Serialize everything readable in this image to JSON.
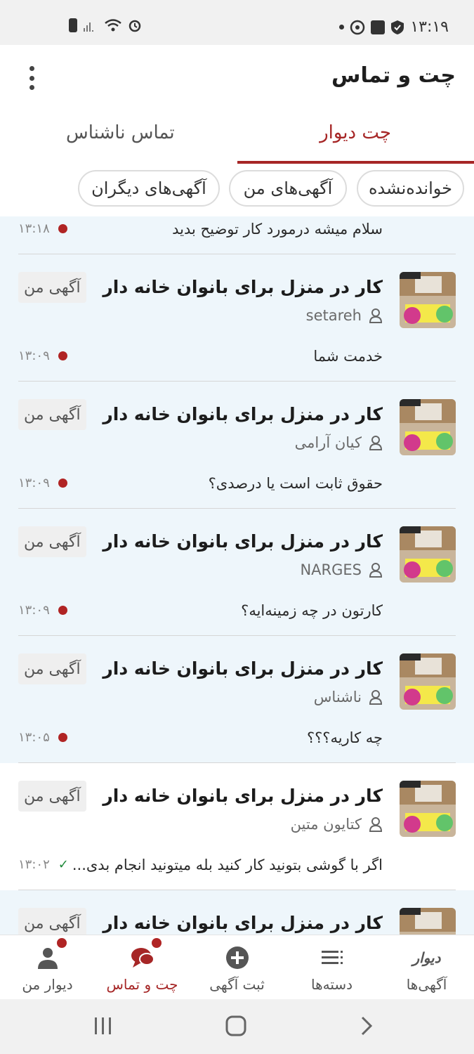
{
  "status_bar": {
    "time": "۱۳:۱۹"
  },
  "header": {
    "title": "چت و تماس"
  },
  "tabs": [
    {
      "label": "چت دیوار",
      "active": true
    },
    {
      "label": "تماس ناشناس",
      "active": false
    }
  ],
  "chips": [
    "خوانده‌نشده",
    "آگهی‌های من",
    "آگهی‌های دیگران"
  ],
  "partial_row": {
    "message": "سلام میشه درمورد کار توضیح بدید",
    "time": "۱۳:۱۸"
  },
  "chats": [
    {
      "title": "کار در منزل برای بانوان خانه دار",
      "user": "setareh",
      "badge": "آگهی من",
      "message": "خدمت شما",
      "time": "۱۳:۰۹",
      "unread": true
    },
    {
      "title": "کار در منزل برای بانوان خانه دار",
      "user": "کیان آرامی",
      "badge": "آگهی من",
      "message": "حقوق ثابت است یا درصدی؟",
      "time": "۱۳:۰۹",
      "unread": true
    },
    {
      "title": "کار در منزل برای بانوان خانه دار",
      "user": "NARGES",
      "badge": "آگهی من",
      "message": "کارتون در چه زمینه‌ایه؟",
      "time": "۱۳:۰۹",
      "unread": true
    },
    {
      "title": "کار در منزل برای بانوان خانه دار",
      "user": "ناشناس",
      "badge": "آگهی من",
      "message": "چه کاریه؟؟؟",
      "time": "۱۳:۰۵",
      "unread": true
    },
    {
      "title": "کار در منزل برای بانوان خانه دار",
      "user": "کتایون متین",
      "badge": "آگهی من",
      "message": "اگر با گوشی بتونید کار کنید بله میتونید انجام بدی...",
      "time": "۱۳:۰۲",
      "unread": false
    },
    {
      "title": "کار در منزل برای بانوان خانه دار",
      "badge": "آگهی من",
      "unread": true
    }
  ],
  "bottom_nav": [
    {
      "label": "دیوار من",
      "icon": "person-icon",
      "notify": true
    },
    {
      "label": "چت و تماس",
      "icon": "chat-icon",
      "notify": true,
      "active": true
    },
    {
      "label": "ثبت آگهی",
      "icon": "plus-circle-icon"
    },
    {
      "label": "دسته‌ها",
      "icon": "list-icon"
    },
    {
      "label": "آگهی‌ها",
      "icon": "divar-logo",
      "logo_text": "دیوار"
    }
  ],
  "colors": {
    "accent": "#a62626",
    "unread_bg": "#eef6fb",
    "dot": "#b02424"
  }
}
